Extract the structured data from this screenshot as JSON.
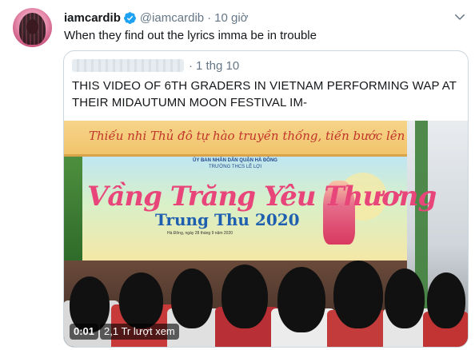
{
  "tweet": {
    "author_name": "iamcardib",
    "author_handle": "@iamcardib",
    "time": "10 giờ",
    "dot": "·",
    "text": "When they find out the lyrics imma be in trouble",
    "icons": {
      "verified": "verified-badge-icon",
      "more": "chevron-down-icon"
    },
    "colors": {
      "verified": "#1da1f2",
      "secondary": "#657786"
    }
  },
  "quoted": {
    "time": "1 thg 10",
    "dot": "·",
    "text": "THIS VIDEO OF 6TH GRADERS IN VIETNAM PERFORMING WAP AT THEIR MIDAUTUMN MOON FESTIVAL IM-",
    "video": {
      "timestamp": "0:01",
      "views": "2,1 Tr lượt xem",
      "scene": {
        "banner_top": "Thiếu nhi Thủ đô tự hào truyền thống, tiến bước lên Đoàn",
        "line1": "ỦY BAN NHÂN DÂN QUẬN HÀ ĐÔNG",
        "line2": "TRƯỜNG THCS LÊ LỢI",
        "title": "Vầng Trăng Yêu Thương",
        "subtitle": "Trung Thu 2020",
        "date_line": "Hà Đông, ngày 28 tháng 9 năm 2020"
      }
    }
  }
}
